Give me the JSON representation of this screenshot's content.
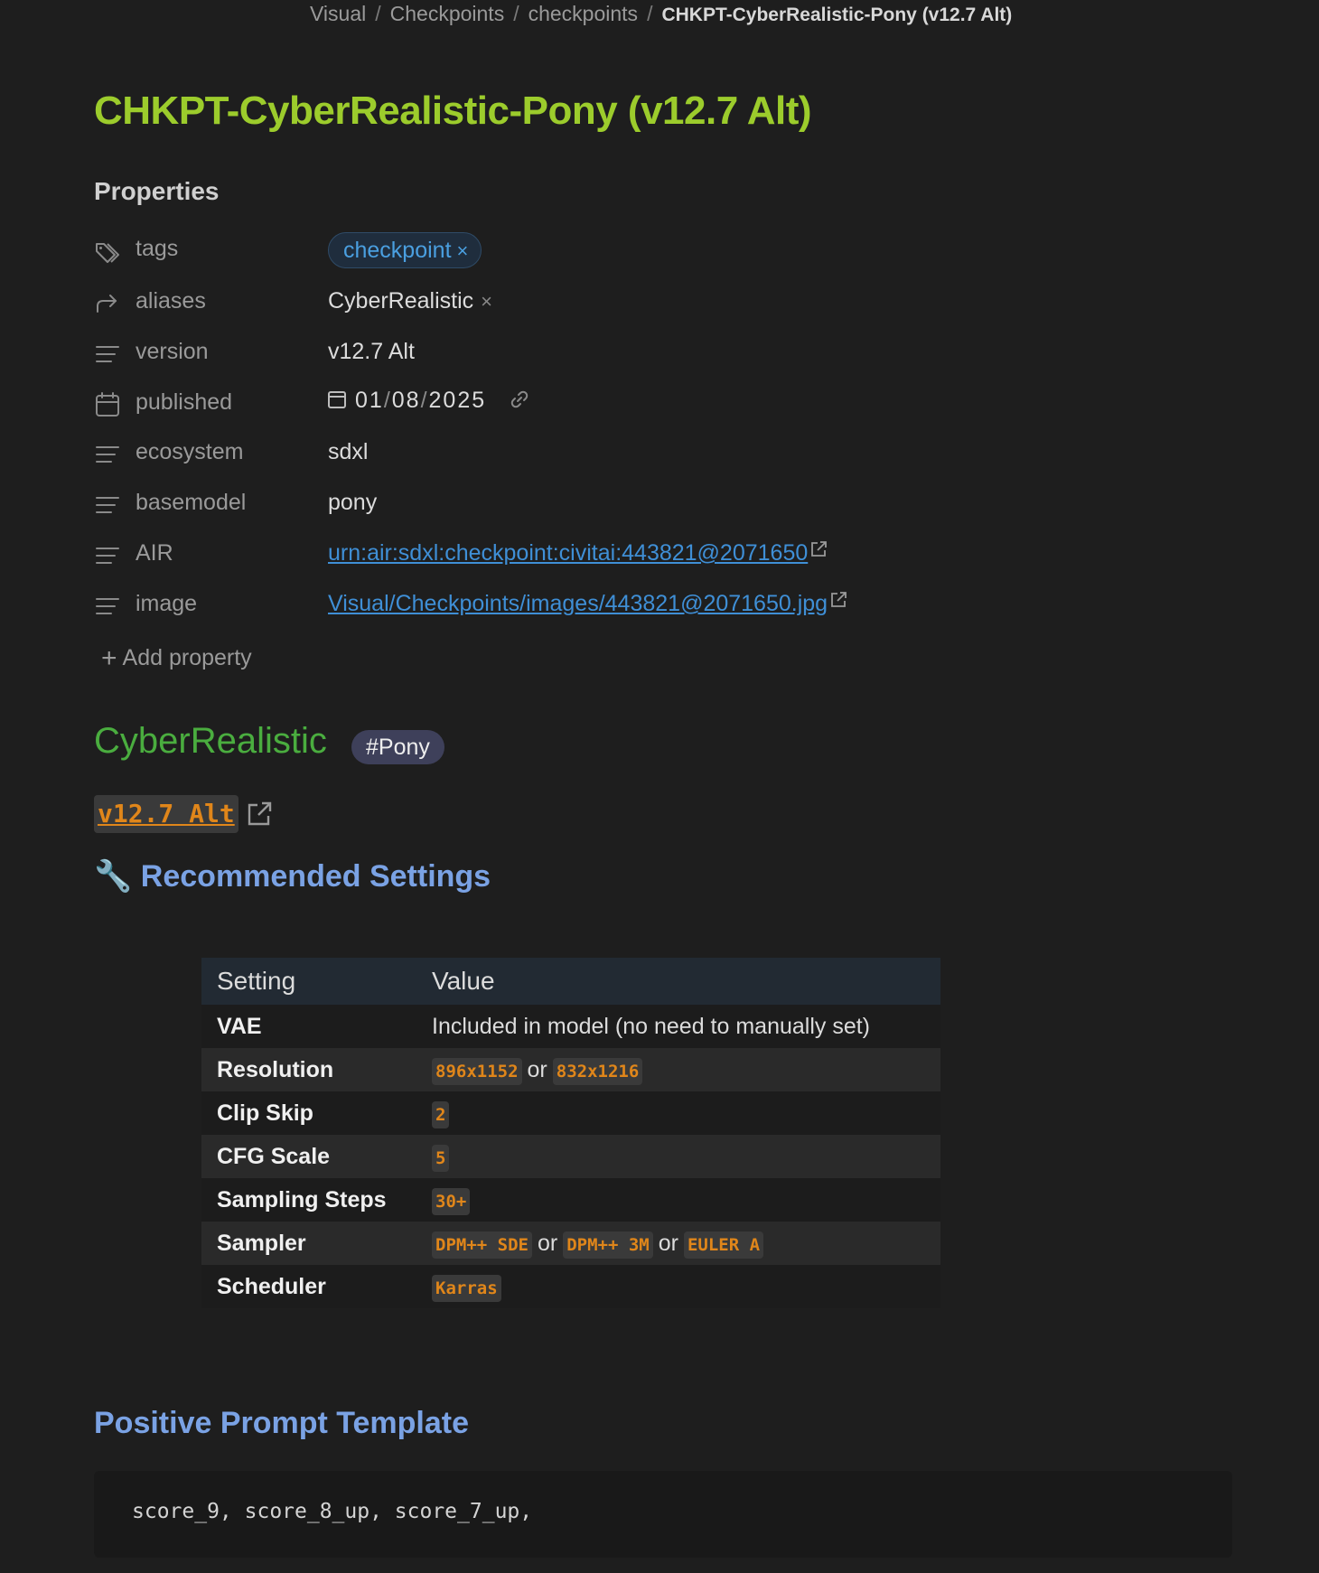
{
  "breadcrumb": {
    "items": [
      "Visual",
      "Checkpoints",
      "checkpoints"
    ],
    "current": "CHKPT-CyberRealistic-Pony (v12.7 Alt)"
  },
  "title": "CHKPT-CyberRealistic-Pony (v12.7 Alt)",
  "properties": {
    "heading": "Properties",
    "tags": {
      "key": "tags",
      "value": "checkpoint",
      "remove": "×"
    },
    "aliases": {
      "key": "aliases",
      "value": "CyberRealistic",
      "remove": "×"
    },
    "version": {
      "key": "version",
      "value": "v12.7 Alt"
    },
    "published": {
      "key": "published",
      "month": "01",
      "day": "08",
      "year": "2025"
    },
    "ecosystem": {
      "key": "ecosystem",
      "value": "sdxl"
    },
    "basemodel": {
      "key": "basemodel",
      "value": "pony"
    },
    "air": {
      "key": "AIR",
      "value": "urn:air:sdxl:checkpoint:civitai:443821@2071650"
    },
    "image": {
      "key": "image",
      "value": "Visual/Checkpoints/images/443821@2071650.jpg"
    },
    "add_label": "Add property"
  },
  "model_heading": "CyberRealistic",
  "model_tag": "#Pony",
  "version_link": "v12.7 Alt",
  "recommended": {
    "heading": "Recommended Settings",
    "emoji": "🔧",
    "columns": [
      "Setting",
      "Value"
    ],
    "rows": [
      {
        "setting": "VAE",
        "text": "Included in model (no need to manually set)"
      },
      {
        "setting": "Resolution",
        "codes": [
          "896x1152",
          "832x1216"
        ]
      },
      {
        "setting": "Clip Skip",
        "codes": [
          "2"
        ]
      },
      {
        "setting": "CFG Scale",
        "codes": [
          "5"
        ]
      },
      {
        "setting": "Sampling Steps",
        "codes": [
          "30+"
        ]
      },
      {
        "setting": "Sampler",
        "codes": [
          "DPM++ SDE",
          "DPM++ 3M",
          "EULER A"
        ]
      },
      {
        "setting": "Scheduler",
        "codes": [
          "Karras"
        ]
      }
    ],
    "or_word": "or"
  },
  "positive_prompt": {
    "heading": "Positive Prompt Template",
    "code": "score_9, score_8_up, score_7_up,"
  }
}
